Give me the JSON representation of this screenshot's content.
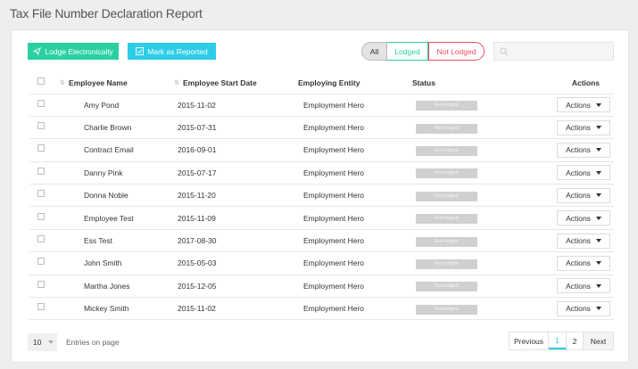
{
  "page": {
    "title": "Tax File Number Declaration Report"
  },
  "toolbar": {
    "lodge_label": "Lodge Electronically",
    "mark_label": "Mark as Reported"
  },
  "filters": {
    "all": "All",
    "lodged": "Lodged",
    "not_lodged": "Not Lodged"
  },
  "search": {
    "placeholder": ""
  },
  "table": {
    "headers": {
      "name": "Employee Name",
      "start_date": "Employee Start Date",
      "entity": "Employing Entity",
      "status": "Status",
      "actions": "Actions"
    },
    "rows": [
      {
        "name": "Amy Pond",
        "start_date": "2015-11-02",
        "entity": "Employment Hero",
        "status": "Not lodged",
        "actions": "Actions"
      },
      {
        "name": "Charlie Brown",
        "start_date": "2015-07-31",
        "entity": "Employment Hero",
        "status": "Not lodged",
        "actions": "Actions"
      },
      {
        "name": "Contract Email",
        "start_date": "2016-09-01",
        "entity": "Employment Hero",
        "status": "Not lodged",
        "actions": "Actions"
      },
      {
        "name": "Danny Pink",
        "start_date": "2015-07-17",
        "entity": "Employment Hero",
        "status": "Not lodged",
        "actions": "Actions"
      },
      {
        "name": "Donna Noble",
        "start_date": "2015-11-20",
        "entity": "Employment Hero",
        "status": "Not lodged",
        "actions": "Actions"
      },
      {
        "name": "Employee Test",
        "start_date": "2015-11-09",
        "entity": "Employment Hero",
        "status": "Not lodged",
        "actions": "Actions"
      },
      {
        "name": "Ess Test",
        "start_date": "2017-08-30",
        "entity": "Employment Hero",
        "status": "Not lodged",
        "actions": "Actions"
      },
      {
        "name": "John Smith",
        "start_date": "2015-05-03",
        "entity": "Employment Hero",
        "status": "Not lodged",
        "actions": "Actions"
      },
      {
        "name": "Martha Jones",
        "start_date": "2015-12-05",
        "entity": "Employment Hero",
        "status": "Not lodged",
        "actions": "Actions"
      },
      {
        "name": "Mickey Smith",
        "start_date": "2015-11-02",
        "entity": "Employment Hero",
        "status": "Not lodged",
        "actions": "Actions"
      }
    ]
  },
  "footer": {
    "page_size": "10",
    "entries_label": "Entries on page"
  },
  "pagination": {
    "previous": "Previous",
    "page1": "1",
    "page2": "2",
    "next": "Next"
  },
  "icons": {
    "lodge": "paper-plane-icon",
    "mark": "checkbox-icon",
    "search": "search-icon"
  },
  "colors": {
    "green": "#2bd0a1",
    "cyan": "#2dcde8",
    "red": "#ef4e64",
    "status_gray": "#d0d0d0"
  }
}
